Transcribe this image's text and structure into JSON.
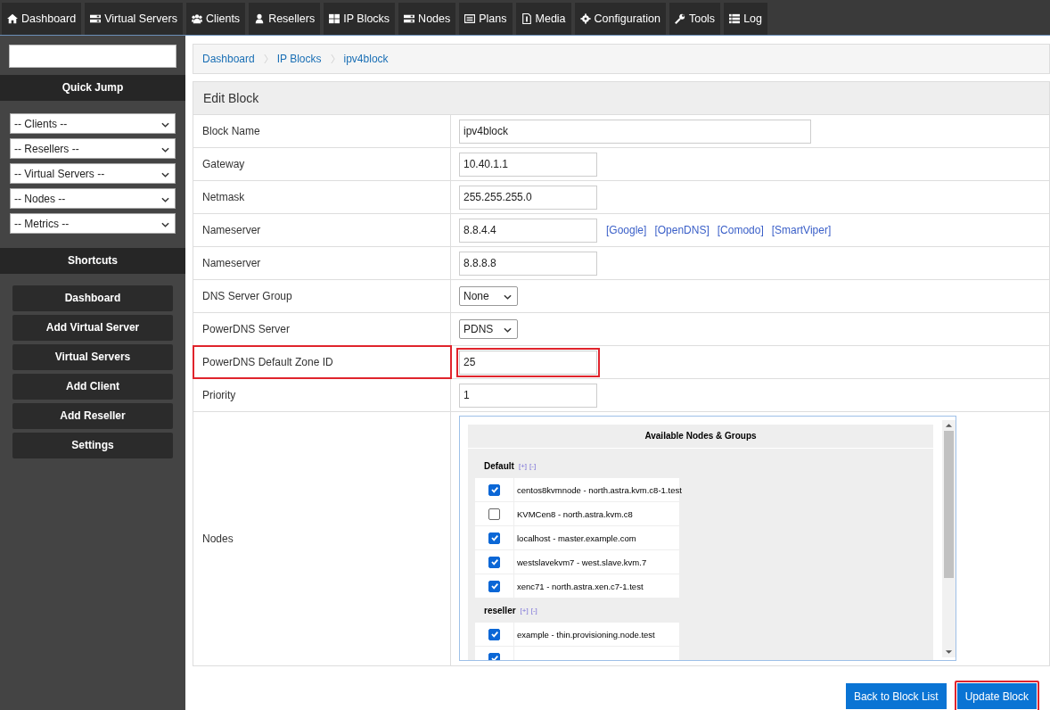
{
  "nav": [
    {
      "label": "Dashboard"
    },
    {
      "label": "Virtual Servers"
    },
    {
      "label": "Clients"
    },
    {
      "label": "Resellers"
    },
    {
      "label": "IP Blocks"
    },
    {
      "label": "Nodes"
    },
    {
      "label": "Plans"
    },
    {
      "label": "Media"
    },
    {
      "label": "Configuration"
    },
    {
      "label": "Tools"
    },
    {
      "label": "Log"
    }
  ],
  "sidebar": {
    "quick_jump_title": "Quick Jump",
    "quick_jump": [
      "-- Clients --",
      "-- Resellers --",
      "-- Virtual Servers --",
      "-- Nodes --",
      "-- Metrics --"
    ],
    "shortcuts_title": "Shortcuts",
    "shortcuts": [
      "Dashboard",
      "Add Virtual Server",
      "Virtual Servers",
      "Add Client",
      "Add Reseller",
      "Settings"
    ]
  },
  "breadcrumb": [
    "Dashboard",
    "IP Blocks",
    "ipv4block"
  ],
  "panel": {
    "title": "Edit Block",
    "rows": [
      {
        "label": "Block Name",
        "kind": "wide",
        "value": "ipv4block",
        "highlighted": false
      },
      {
        "label": "Gateway",
        "kind": "text",
        "value": "10.40.1.1",
        "highlighted": false
      },
      {
        "label": "Netmask",
        "kind": "text",
        "value": "255.255.255.0",
        "highlighted": false
      },
      {
        "label": "Nameserver",
        "kind": "text",
        "value": "8.8.4.4",
        "highlighted": false,
        "links": [
          "[Google]",
          "[OpenDNS]",
          "[Comodo]",
          "[SmartViper]"
        ]
      },
      {
        "label": "Nameserver",
        "kind": "text",
        "value": "8.8.8.8",
        "highlighted": false
      },
      {
        "label": "DNS Server Group",
        "kind": "select",
        "value": "None",
        "highlighted": false
      },
      {
        "label": "PowerDNS Server",
        "kind": "select",
        "value": "PDNS",
        "highlighted": false
      },
      {
        "label": "PowerDNS Default Zone ID",
        "kind": "text",
        "value": "25",
        "highlighted": true
      },
      {
        "label": "Priority",
        "kind": "text",
        "value": "1",
        "highlighted": false
      },
      {
        "label": "Nodes",
        "kind": "nodes",
        "highlighted": false
      }
    ]
  },
  "nodes": {
    "title": "Available Nodes & Groups",
    "groups": [
      {
        "name": "Default",
        "expand": "[+]",
        "collapse": "[-]",
        "nodes": [
          {
            "label": "centos8kvmnode - north.astra.kvm.c8-1.test",
            "checked": true
          },
          {
            "label": "KVMCen8 - north.astra.kvm.c8",
            "checked": false
          },
          {
            "label": "localhost - master.example.com",
            "checked": true
          },
          {
            "label": "westslavekvm7 - west.slave.kvm.7",
            "checked": true
          },
          {
            "label": "xenc71 - north.astra.xen.c7-1.test",
            "checked": true
          }
        ]
      },
      {
        "name": "reseller",
        "expand": "[+]",
        "collapse": "[-]",
        "nodes": [
          {
            "label": "example - thin.provisioning.node.test",
            "checked": true
          },
          {
            "checked": true
          }
        ]
      }
    ]
  },
  "buttons": [
    {
      "label": "Back to Block List",
      "highlighted": false
    },
    {
      "label": "Update Block",
      "highlighted": true
    }
  ]
}
